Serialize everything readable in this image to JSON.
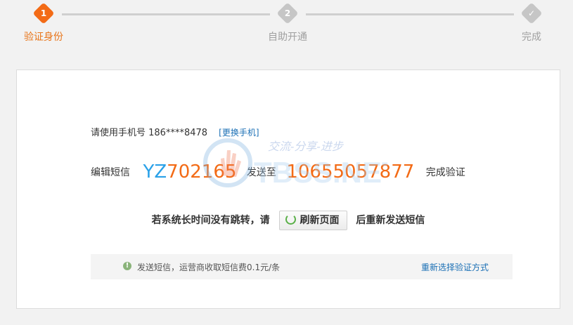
{
  "stepper": {
    "steps": [
      {
        "number": "1",
        "label": "验证身份",
        "state": "active"
      },
      {
        "number": "2",
        "label": "自助开通",
        "state": "pending"
      },
      {
        "number": "✓",
        "label": "完成",
        "state": "pending"
      }
    ]
  },
  "verify": {
    "phone_prefix": "请使用手机号 186****8478",
    "change_phone": "[更换手机]",
    "sms_label": "编辑短信",
    "code_prefix": "YZ",
    "code_number": "702165",
    "send_to": "发送至",
    "target_number": "10655057877",
    "complete_label": "完成验证"
  },
  "refresh": {
    "before": "若系统长时间没有跳转，请",
    "button": "刷新页面",
    "after": "后重新发送短信"
  },
  "notice": {
    "icon": "!",
    "message": "发送短信，运营商收取短信费0.1元/条",
    "reselect": "重新选择验证方式"
  },
  "watermark": {
    "slogan": "交流-分享-进步",
    "brand": "TBSS.NET"
  },
  "colors": {
    "accent_orange": "#f36b16",
    "code_blue": "#2aa1e8",
    "link_blue": "#1a6fb5",
    "inactive_gray": "#c6c6c6"
  }
}
